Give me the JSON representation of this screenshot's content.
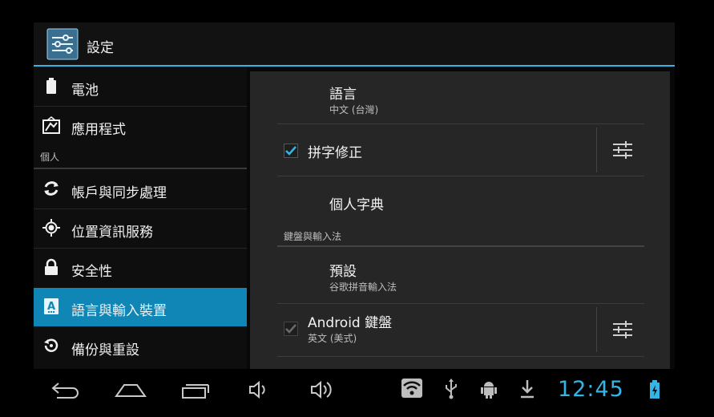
{
  "header": {
    "title": "設定",
    "app_icon": "settings-sliders-icon"
  },
  "sidebar": {
    "items": [
      {
        "label": "電池",
        "icon": "battery-icon"
      },
      {
        "label": "應用程式",
        "icon": "apps-icon"
      },
      {
        "section": "個人"
      },
      {
        "label": "帳戶與同步處理",
        "icon": "sync-icon"
      },
      {
        "label": "位置資訊服務",
        "icon": "location-icon"
      },
      {
        "label": "安全性",
        "icon": "lock-icon"
      },
      {
        "label": "語言與輸入裝置",
        "icon": "language-icon",
        "selected": true
      },
      {
        "label": "備份與重設",
        "icon": "backup-icon"
      }
    ]
  },
  "detail": {
    "language": {
      "title": "語言",
      "summary": "中文 (台灣)"
    },
    "spell_check": {
      "title": "拼字修正",
      "checked": true
    },
    "user_dictionary": {
      "title": "個人字典"
    },
    "keyboard_section": "鍵盤與輸入法",
    "default_ime": {
      "title": "預設",
      "summary": "谷歌拼音輸入法"
    },
    "android_keyboard": {
      "title": "Android 鍵盤",
      "summary": "英文 (美式)",
      "checked": true
    }
  },
  "statusbar": {
    "time": "12:45",
    "accent": "#33b5e5",
    "icons": [
      "back-icon",
      "home-icon",
      "recent-apps-icon",
      "volume-down-icon",
      "volume-up-icon",
      "wifi-icon",
      "usb-icon",
      "android-debug-icon",
      "download-icon",
      "battery-charging-icon"
    ]
  },
  "colors": {
    "accent": "#33b5e5",
    "selected": "#0f86b5"
  }
}
